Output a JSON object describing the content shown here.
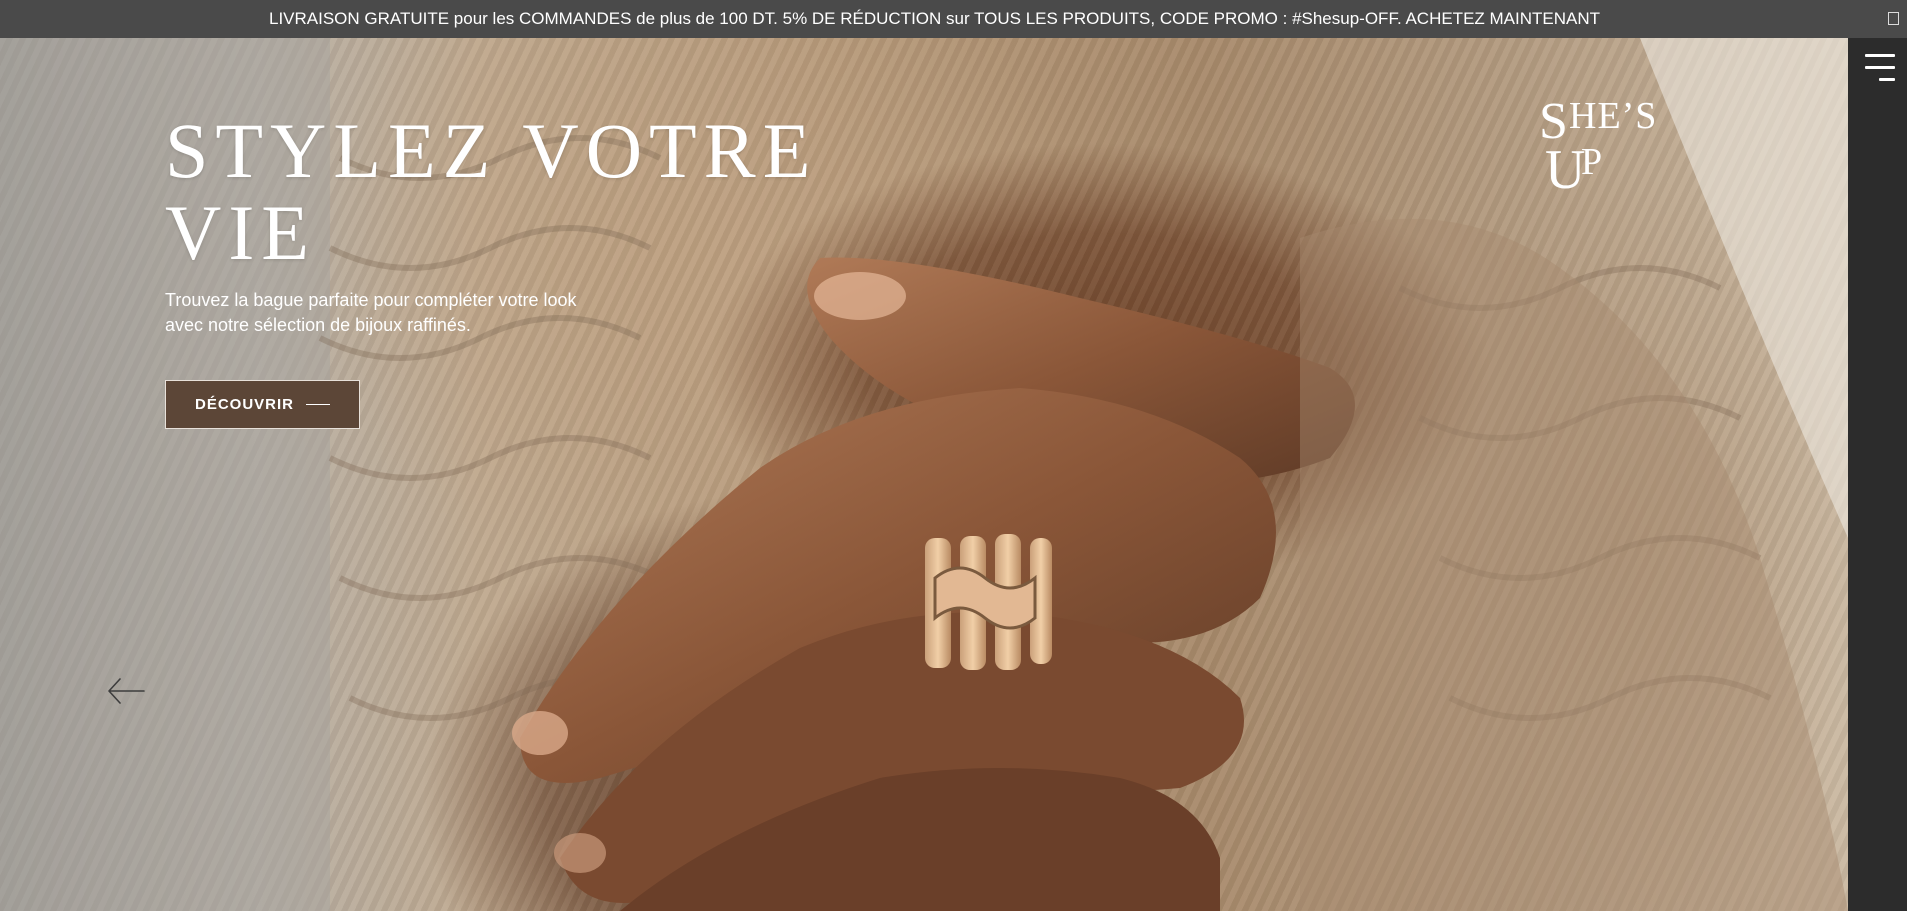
{
  "announcement": {
    "text": "LIVRAISON GRATUITE pour les COMMANDES de plus de 100 DT. 5% DE RÉDUCTION sur TOUS LES PRODUITS, CODE PROMO : #Shesup-OFF. ACHETEZ MAINTENANT"
  },
  "brand": {
    "logo_text": "SHE'S UP",
    "color": "#ffffff"
  },
  "hero": {
    "title": "STYLEZ VOTRE VIE",
    "subtitle_line1": "Trouvez la bague parfaite pour compléter votre look",
    "subtitle_line2": "avec notre sélection de bijoux raffinés.",
    "cta_label": "DÉCOUVRIR",
    "cta_color": "#5c4637"
  },
  "navigation": {
    "menu_icon": "hamburger-icon",
    "prev_icon": "arrow-left-icon"
  }
}
